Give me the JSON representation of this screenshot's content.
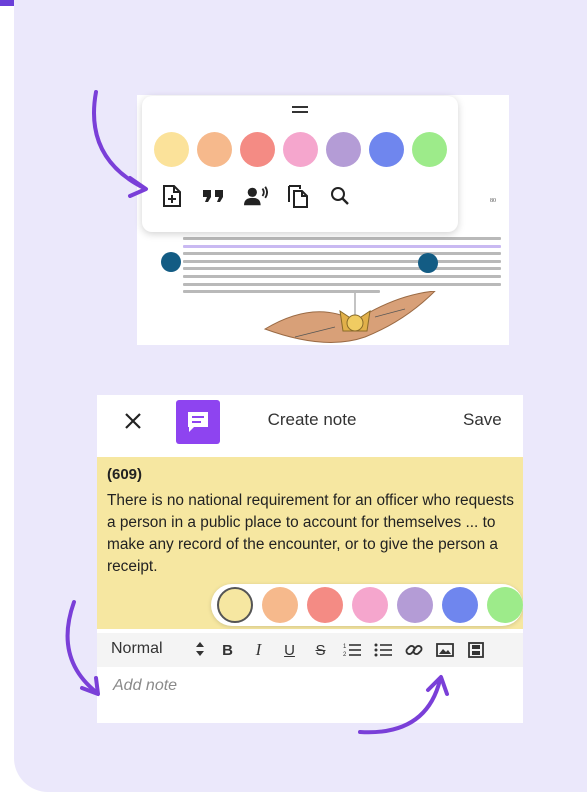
{
  "colors": {
    "accent": "#6a3fd8",
    "card_background": "#ebe8fb",
    "note_background": "#f6e7a1",
    "badge": "#8e44f0",
    "handle": "#135c84"
  },
  "highlight_toolbar": {
    "swatches": [
      "#fbe29a",
      "#f6b98c",
      "#f48b84",
      "#f5a6cd",
      "#b49cd6",
      "#6f86ee",
      "#9deb8a"
    ],
    "tools": [
      {
        "name": "add-note-icon"
      },
      {
        "name": "quote-icon"
      },
      {
        "name": "read-aloud-icon"
      },
      {
        "name": "copy-icon"
      },
      {
        "name": "search-icon"
      }
    ]
  },
  "note_editor": {
    "header": {
      "title": "Create note",
      "save_label": "Save"
    },
    "page_ref": "(609)",
    "quote": "There is no national requirement for an officer who requests a person in a public place to account for themselves ... to make any record of the encounter, or to give the person a receipt.",
    "swatches": [
      "#f6e7a1",
      "#f6b98c",
      "#f48b84",
      "#f5a6cd",
      "#b49cd6",
      "#6f86ee",
      "#9deb8a"
    ],
    "format_bar": {
      "style_value": "Normal",
      "tools": [
        "B",
        "I",
        "U",
        "S"
      ]
    },
    "placeholder": "Add note"
  }
}
